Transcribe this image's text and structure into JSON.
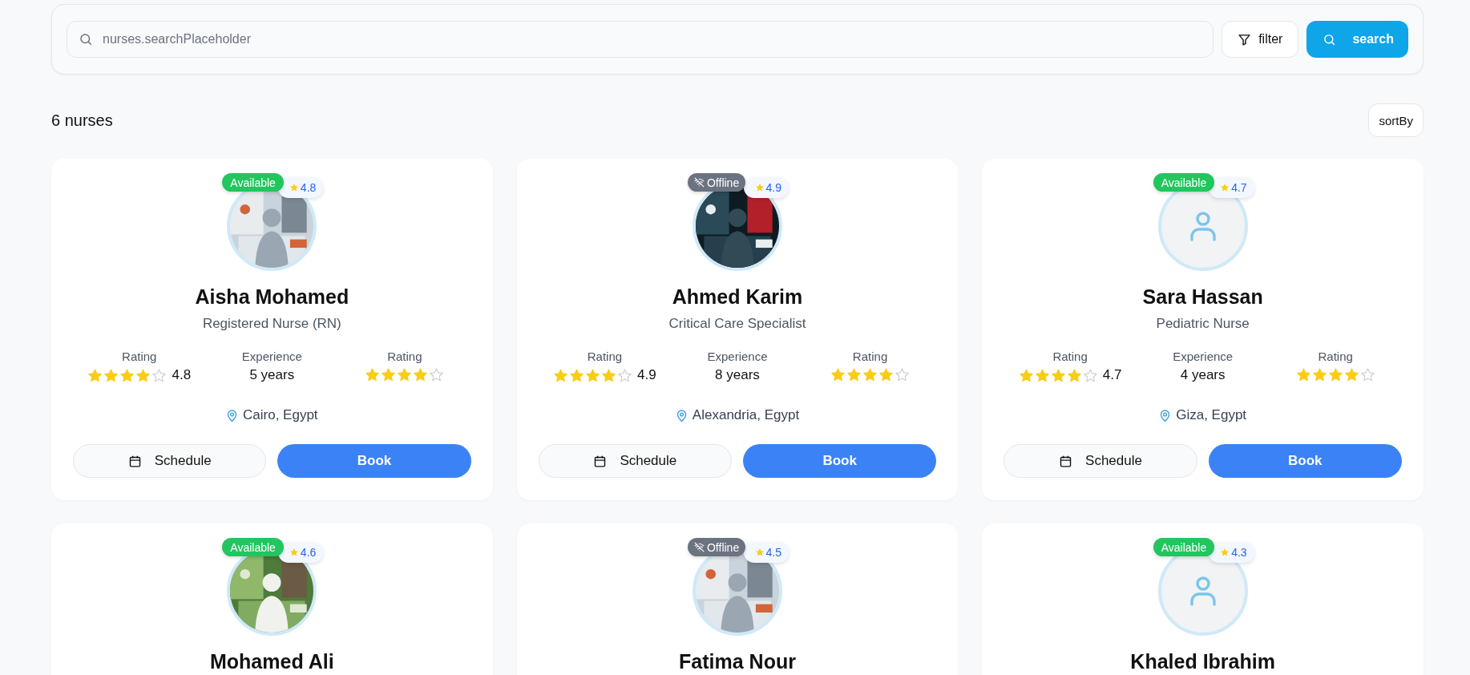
{
  "search": {
    "placeholder": "nurses.searchPlaceholder",
    "filter_label": "filter",
    "search_label": "search"
  },
  "results": {
    "count_label": "6 nurses",
    "sort_label": "sortBy"
  },
  "nurses": [
    {
      "name": "Aisha Mohamed",
      "role": "Registered Nurse (RN)",
      "online": true,
      "status_label": "Available",
      "badge_rating": "4.8",
      "stats": [
        {
          "kind": "stars_value",
          "label": "Rating",
          "stars": 4,
          "value": "4.8"
        },
        {
          "kind": "text",
          "label": "Experience",
          "value": "5 years"
        },
        {
          "kind": "stars",
          "label": "Rating",
          "stars": 4
        }
      ],
      "location": "Cairo, Egypt",
      "schedule_label": "Schedule",
      "book_label": "Book"
    },
    {
      "name": "Ahmed Karim",
      "role": "Critical Care Specialist",
      "online": false,
      "status_label": "Offline",
      "badge_rating": "4.9",
      "stats": [
        {
          "kind": "stars_value",
          "label": "Rating",
          "stars": 4,
          "value": "4.9"
        },
        {
          "kind": "text",
          "label": "Experience",
          "value": "8 years"
        },
        {
          "kind": "stars",
          "label": "Rating",
          "stars": 4
        }
      ],
      "location": "Alexandria, Egypt",
      "schedule_label": "Schedule",
      "book_label": "Book"
    },
    {
      "name": "Sara Hassan",
      "role": "Pediatric Nurse",
      "online": true,
      "status_label": "Available",
      "badge_rating": "4.7",
      "kind": "placeholder",
      "stats": [
        {
          "kind": "stars_value",
          "label": "Rating",
          "stars": 4,
          "value": "4.7"
        },
        {
          "kind": "text",
          "label": "Experience",
          "value": "4 years"
        },
        {
          "kind": "stars",
          "label": "Rating",
          "stars": 4
        }
      ],
      "location": "Giza, Egypt",
      "schedule_label": "Schedule",
      "book_label": "Book"
    },
    {
      "name": "Mohamed Ali",
      "online": true,
      "status_label": "Available",
      "badge_rating": "4.6"
    },
    {
      "name": "Fatima Nour",
      "online": false,
      "status_label": "Offline",
      "badge_rating": "4.5"
    },
    {
      "name": "Khaled Ibrahim",
      "online": true,
      "status_label": "Available",
      "badge_rating": "4.3",
      "kind": "placeholder"
    }
  ]
}
